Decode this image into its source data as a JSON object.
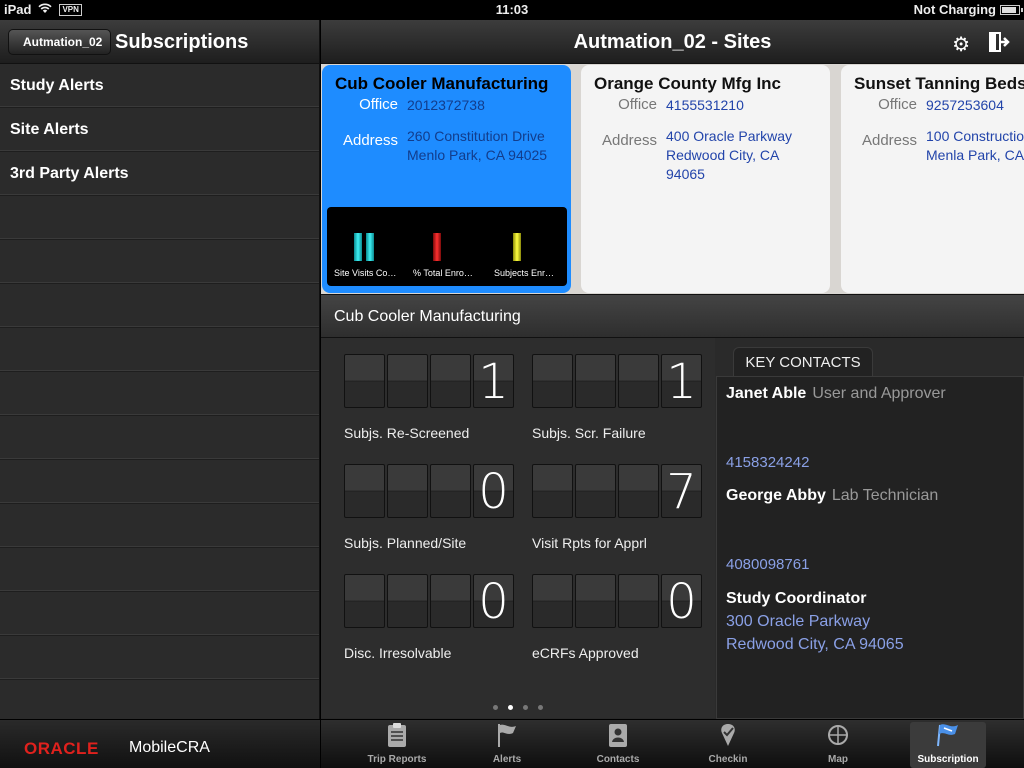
{
  "status": {
    "device": "iPad",
    "vpn": "VPN",
    "time": "11:03",
    "charging": "Not Charging",
    "battery_level": 0.9
  },
  "left": {
    "back_label": "Autmation_02",
    "title": "Subscriptions",
    "items": [
      {
        "label": "Study Alerts"
      },
      {
        "label": "Site Alerts"
      },
      {
        "label": "3rd Party Alerts"
      }
    ],
    "footer_brand": "ORACLE",
    "footer_app": "MobileCRA"
  },
  "header": {
    "title": "Autmation_02 - Sites",
    "gear_icon": "gear-icon",
    "logout_icon": "logout-icon"
  },
  "sites": [
    {
      "name": "Cub Cooler Manufacturing",
      "office_label": "Office",
      "office": "2012372738",
      "address_label": "Address",
      "address_line1": "260 Constitution Drive",
      "address_line2": "Menlo Park, CA 94025",
      "address_line3": ""
    },
    {
      "name": "Orange County Mfg Inc",
      "office_label": "Office",
      "office": "4155531210",
      "address_label": "Address",
      "address_line1": "400 Oracle Parkway",
      "address_line2": "Redwood City, CA",
      "address_line3": "94065"
    },
    {
      "name": "Sunset Tanning Beds",
      "office_label": "Office",
      "office": "9257253604",
      "address_label": "Address",
      "address_line1": "100 Constructio",
      "address_line2": "Menla Park, CA",
      "address_line3": ""
    }
  ],
  "chart_data": {
    "type": "bar",
    "categories": [
      "Site Visits Co…",
      "% Total Enro…",
      "Subjects Enr…"
    ],
    "colors": [
      "#1fc3c8",
      "#c81f1f",
      "#d8d81f"
    ]
  },
  "detail": {
    "title": "Cub Cooler Manufacturing",
    "metrics": [
      {
        "label": "Subjs. Re-Screened",
        "value": "1"
      },
      {
        "label": "Subjs. Scr. Failure",
        "value": "1"
      },
      {
        "label": "Subjs. Planned/Site",
        "value": "0"
      },
      {
        "label": "Visit Rpts for Apprl",
        "value": "7"
      },
      {
        "label": "Disc. Irresolvable",
        "value": "0"
      },
      {
        "label": "eCRFs Approved",
        "value": "0"
      }
    ],
    "key_contacts_title": "KEY CONTACTS",
    "contacts": [
      {
        "name": "Janet Able",
        "role": "User and Approver",
        "phone": "4158324242"
      },
      {
        "name": "George Abby",
        "role": "Lab Technician",
        "phone": "4080098761"
      },
      {
        "name": "Study Coordinator",
        "address_line1": "300 Oracle Parkway",
        "address_line2": "Redwood City, CA 94065"
      }
    ]
  },
  "tabs": [
    {
      "label": "Trip Reports",
      "icon": "clipboard-icon"
    },
    {
      "label": "Alerts",
      "icon": "flag-icon"
    },
    {
      "label": "Contacts",
      "icon": "address-book-icon"
    },
    {
      "label": "Checkin",
      "icon": "checkin-pin-icon"
    },
    {
      "label": "Map",
      "icon": "crosshair-icon"
    },
    {
      "label": "Subscription",
      "icon": "subscription-flag-icon",
      "active": true
    }
  ]
}
